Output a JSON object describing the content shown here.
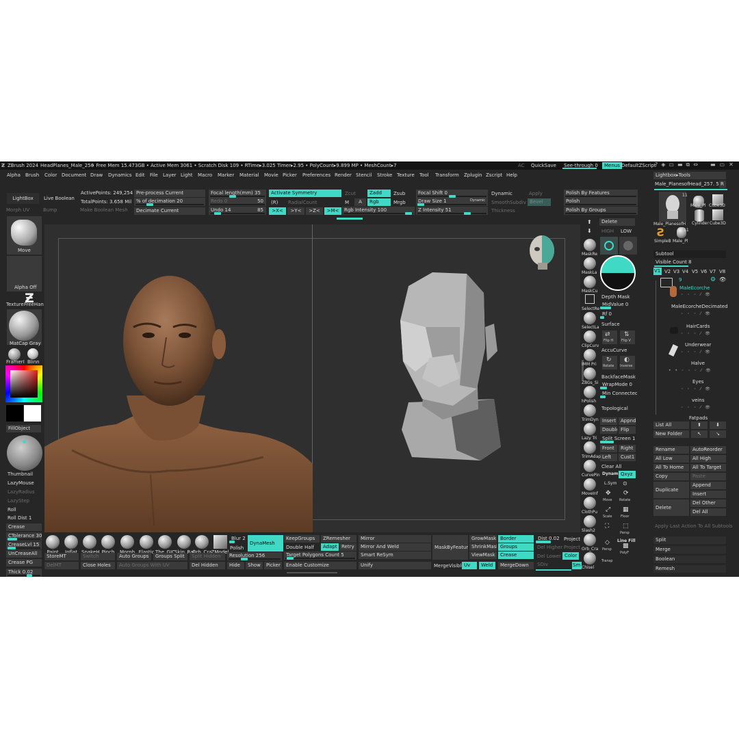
{
  "titlebar": {
    "app": "ZBrush 2024",
    "doc": "HeadPlanes_Male_256",
    "stats": "• Free Mem 15.473GB • Active Mem 3061 • Scratch Disk 109 • RTime▸3.025 Timer▸2.95 • PolyCount▸9.899 MP • MeshCount▸7",
    "ac": "AC",
    "quicksave": "QuickSave",
    "see_through": "See-through",
    "see_through_val": "0",
    "menus": "Menus",
    "default_script": "DefaultZScript"
  },
  "menubar": [
    "Alpha",
    "Brush",
    "Color",
    "Document",
    "Draw",
    "Dynamics",
    "Edit",
    "File",
    "Layer",
    "Light",
    "Macro",
    "Marker",
    "Material",
    "Movie",
    "Picker",
    "Preferences",
    "Render",
    "Stencil",
    "Stroke",
    "Texture",
    "Tool",
    "Transform",
    "Zplugin",
    "Zscript",
    "Help"
  ],
  "topshelf": {
    "lightbox": "LightBox",
    "live_boolean": "Live Boolean",
    "morph_uv": "Morph UV",
    "bump": "Bump",
    "make_boolean_mesh": "Make Boolean Mesh",
    "active_points": "ActivePoints: 249,254",
    "total_points": "TotalPoints: 3.658 Mil",
    "preprocess": "Pre-process Current",
    "pct_decimation": "% of decimation 20",
    "decimate_current": "Decimate Current",
    "focal_length": "Focal length(mm) 35",
    "redo": "Redo 0",
    "redo_val": "50",
    "undo": "Undo 14",
    "undo_val": "85",
    "activate_symmetry": "Activate Symmetry",
    "r": "(R)",
    "radial_count": "RadialCount",
    "sym_x": ">X<",
    "sym_y": ">Y<",
    "sym_z": ">Z<",
    "sym_m": ">M<",
    "zcut": "Zcut",
    "m": "M",
    "zadd": "Zadd",
    "a": "A",
    "rgb": "Rgb",
    "rgb_intensity": "Rgb Intensity 100",
    "zsub": "Zsub",
    "mrgb": "Mrgb",
    "focal_shift": "Focal Shift 0",
    "draw_size": "Draw Size 1",
    "dynamic_small": "Dynamic",
    "z_intensity": "Z Intensity 51",
    "dynamic": "Dynamic",
    "smooth_subdiv": "SmoothSubdiv",
    "thickness": "Thickness",
    "apply": "Apply",
    "bevel": "Bevel",
    "polish_by_features": "Polish By Features",
    "polish": "Polish",
    "polish_by_groups": "Polish By Groups"
  },
  "leftpanel": {
    "move": "Move",
    "alpha_off": "Alpha Off",
    "texture": "Texture",
    "freehand": "FreeHan",
    "matcap_gray": "MatCap Gray",
    "framer": "FramerI",
    "blinn": "Blinn",
    "fill_object": "FillObject",
    "thumbnail": "Thumbnail",
    "lazymouse": "LazyMouse",
    "lazyradius": "LazyRadius",
    "lazystep": "LazyStep",
    "roll": "Roll",
    "roll_dist": "Roll Dist 1",
    "crease": "Crease",
    "ctolerance": "CTolerance 30",
    "creaselvl": "CreaseLvl 15",
    "uncrease_all": "UnCreaseAll",
    "crease_pg": "Crease PG",
    "thick": "Thick 0.02"
  },
  "rightshelf": {
    "delete": "Delete",
    "high": "HIGH",
    "low": "LOW",
    "labels": [
      "MaskRe",
      "MaskLa",
      "MaskCu",
      "SelectRe",
      "SelectLa",
      "ClipCurv",
      "IMM Pri",
      "ZBGs_Si",
      "hPolish",
      "TrimDyn",
      "Lazy Tri",
      "TrimAdap",
      "CurvePin",
      "MoveInf",
      "ClothPu",
      "Slash2",
      "Orb_Cra",
      "Chisel"
    ],
    "depth_mask": "Depth Mask",
    "midvalue": "MidValue 0",
    "rf": "Rf 0",
    "surface": "Surface",
    "accucurve": "AccuCurve",
    "backfacemask": "BackfaceMask",
    "wrapmode": "WrapMode 0",
    "min_connected": "Min Connected I",
    "topological": "Topological",
    "insert": "Insert",
    "appnd": "Appnd",
    "double": "Double",
    "flip": "Flip",
    "split_screen": "Split Screen 1",
    "front": "Front",
    "right": "Right",
    "left": "Left",
    "cust1": "Cust1",
    "clear_all": "Clear All",
    "dynamic": "Dynamic",
    "lsym": "L.Sym",
    "qxyz": "Qxyz",
    "move": "Move",
    "rotate": "Rotate",
    "scale": "Scale",
    "floor": "Floor",
    "persp": "Persp",
    "linefill": "Line Fill",
    "polyf": "PolyF",
    "transp": "Transp",
    "flip_h": "Flip H",
    "flip_v": "Flip V",
    "rotate2": "Rotate",
    "inverse": "Inverse"
  },
  "tools": {
    "lightbox_tools": "Lightbox▸Tools",
    "current": "Male_PlanesofHead_257. 50",
    "r": "R",
    "count": "11",
    "thumb_main": "Male_PlanesofH",
    "thumb2": "Male_Pl",
    "thumb3": "Cube3D",
    "thumb4": "Cylinder",
    "thumb5": "Cube3D",
    "thumb6": "SimpleB",
    "thumb7": "Male_Pl",
    "thumb7_count": "11",
    "subtool": "Subtool",
    "visible_count": "Visible Count 8",
    "v_tabs": [
      "V1",
      "V2",
      "V3",
      "V4",
      "V5",
      "V6",
      "V7",
      "V8"
    ],
    "folder_count": "9",
    "items": [
      "MaleEcorche",
      "MaleEcorcheDecimated",
      "HairCards",
      "Underwear",
      "Halve",
      "Eyes",
      "veins"
    ],
    "fatpads": "Fatpads",
    "list_all": "List All",
    "new_folder": "New Folder",
    "rename": "Rename",
    "autoreorder": "AutoReorder",
    "all_low": "All Low",
    "all_high": "All High",
    "all_to_home": "All To Home",
    "all_to_target": "All To Target",
    "copy": "Copy",
    "paste": "Paste",
    "duplicate": "Duplicate",
    "append": "Append",
    "insert": "Insert",
    "delete": "Delete",
    "del_other": "Del Other",
    "del_all": "Del All",
    "apply_last": "Apply Last Action To All Subtools",
    "split": "Split",
    "merge": "Merge",
    "boolean": "Boolean",
    "remesh": "Remesh"
  },
  "bottom": {
    "brushes": [
      "Paint",
      "Inflat",
      "SnakeH",
      "Pinch",
      "Morph",
      "Elastic",
      "The_GIC",
      "Skin_Rai",
      "Orb_Cra",
      "ZModel"
    ],
    "blur": "Blur 2",
    "polish": "Polish",
    "dynamesh": "DynaMesh",
    "storemt": "StoreMT",
    "switch": "Switch",
    "delmt": "DelMT",
    "close_holes": "Close Holes",
    "auto_groups": "Auto Groups",
    "groups_split": "Groups Split",
    "split_hidden": "Split Hidden",
    "auto_groups_uv": "Auto Groups With UV",
    "del_hidden": "Del Hidden",
    "resolution": "Resolution 256",
    "hide": "Hide",
    "show": "Show",
    "picker": "Picker",
    "keepgroups": "KeepGroups",
    "zremesher": "ZRemesher",
    "double": "Double",
    "half": "Half",
    "adapt": "Adapt",
    "retry": "Retry",
    "target_polygons": "Target Polygons Count 5",
    "enable_customize": "Enable Customize",
    "mirror": "Mirror",
    "mirror_and_weld": "Mirror And Weld",
    "smart_resym": "Smart ReSym",
    "unify": "Unify",
    "maskbyfeature": "MaskByFeature",
    "mergevisible": "MergeVisible",
    "growmask": "GrowMask",
    "shrinkmask": "ShrinkMask",
    "viewmask": "ViewMask",
    "uv": "Uv",
    "weld": "Weld",
    "border": "Border",
    "groups": "Groups",
    "crease": "Crease",
    "mergedown": "MergeDown",
    "dist": "Dist 0.02",
    "del_higher": "Del Higher",
    "del_lower": "Del Lower",
    "sdiv": "SDiv",
    "project": "Project",
    "project2": "Project",
    "color": "Color",
    "sm": "Sm"
  },
  "colors": {
    "accent": "#3fd9c6",
    "panel": "#262626",
    "button": "#3a3a3a",
    "canvas": "#2f2f2f"
  }
}
